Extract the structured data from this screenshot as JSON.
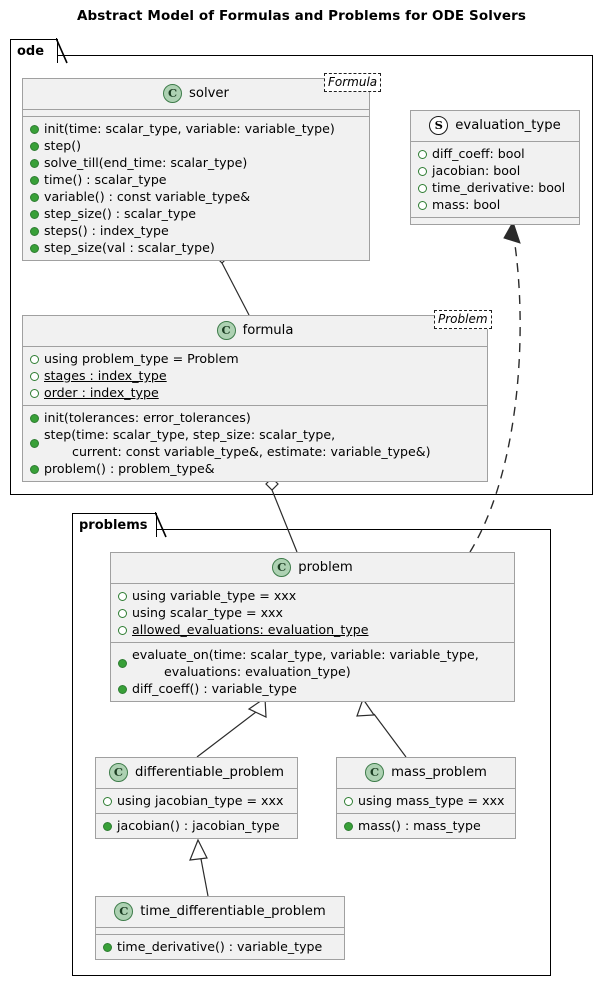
{
  "title": "Abstract Model of Formulas and Problems for ODE Solvers",
  "packages": [
    {
      "name": "ode"
    },
    {
      "name": "problems"
    }
  ],
  "classes": {
    "solver": {
      "name": "solver",
      "icon": "class-icon",
      "stereotype": "Formula",
      "fields": [],
      "methods": [
        "init(time: scalar_type, variable: variable_type)",
        "step()",
        "solve_till(end_time: scalar_type)",
        "time() : scalar_type",
        "variable() : const variable_type&",
        "step_size() : scalar_type",
        "steps() : index_type",
        "step_size(val : scalar_type)"
      ]
    },
    "evaluation_type": {
      "name": "evaluation_type",
      "icon": "struct-icon",
      "fields": [
        "diff_coeff: bool",
        "jacobian: bool",
        "time_derivative: bool",
        "mass: bool"
      ],
      "methods": []
    },
    "formula": {
      "name": "formula",
      "icon": "class-icon",
      "stereotype": "Problem",
      "fields": [
        {
          "text": "using problem_type = Problem",
          "static": false
        },
        {
          "text": "stages : index_type",
          "static": true
        },
        {
          "text": "order : index_type",
          "static": true
        }
      ],
      "methods": [
        {
          "lines": [
            "init(tolerances: error_tolerances)"
          ]
        },
        {
          "lines": [
            "step(time: scalar_type, step_size: scalar_type,",
            "       current: const variable_type&, estimate: variable_type&)"
          ]
        },
        {
          "lines": [
            "problem() : problem_type&"
          ]
        }
      ]
    },
    "problem": {
      "name": "problem",
      "icon": "class-icon",
      "fields": [
        {
          "text": "using variable_type = xxx",
          "static": false
        },
        {
          "text": "using scalar_type = xxx",
          "static": false
        },
        {
          "text": "allowed_evaluations: evaluation_type",
          "static": true
        }
      ],
      "methods": [
        {
          "lines": [
            "evaluate_on(time: scalar_type, variable: variable_type,",
            "        evaluations: evaluation_type)"
          ]
        },
        {
          "lines": [
            "diff_coeff() : variable_type"
          ]
        }
      ]
    },
    "differentiable_problem": {
      "name": "differentiable_problem",
      "icon": "class-icon",
      "fields": [
        "using jacobian_type = xxx"
      ],
      "methods": [
        "jacobian() : jacobian_type"
      ]
    },
    "mass_problem": {
      "name": "mass_problem",
      "icon": "class-icon",
      "fields": [
        "using mass_type = xxx"
      ],
      "methods": [
        "mass() : mass_type"
      ]
    },
    "time_differentiable_problem": {
      "name": "time_differentiable_problem",
      "icon": "class-icon",
      "fields": [],
      "methods": [
        "time_derivative() : variable_type"
      ]
    }
  },
  "relations": [
    {
      "from": "solver",
      "to": "formula",
      "type": "aggregation"
    },
    {
      "from": "formula",
      "to": "problem",
      "type": "aggregation"
    },
    {
      "from": "differentiable_problem",
      "to": "problem",
      "type": "inheritance"
    },
    {
      "from": "mass_problem",
      "to": "problem",
      "type": "inheritance"
    },
    {
      "from": "time_differentiable_problem",
      "to": "differentiable_problem",
      "type": "inheritance"
    },
    {
      "from": "problem",
      "to": "evaluation_type",
      "type": "dependency"
    }
  ],
  "colors": {
    "class_fill": "#F1F1F1",
    "class_border": "#A0A0A0",
    "class_icon_fill": "#ADD1B2",
    "class_icon_border": "#3E7C4A",
    "method_marker": "#38A038",
    "field_marker_border": "#2E7D32",
    "package_border": "#000000",
    "background": "#FFFFFF"
  }
}
